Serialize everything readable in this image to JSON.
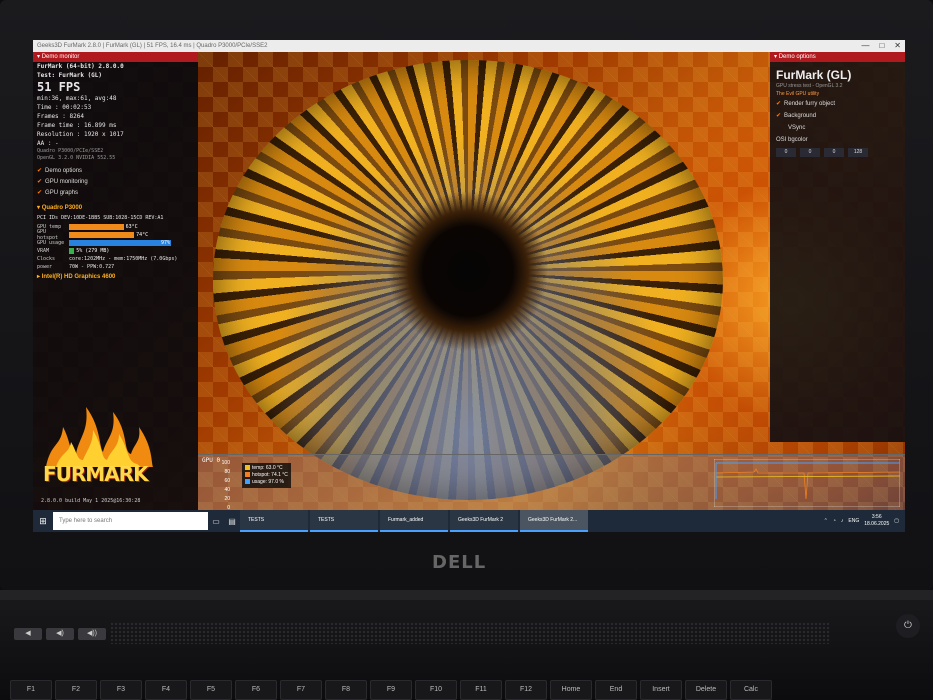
{
  "window": {
    "title": "Geeks3D FurMark 2.8.0   |  FurMark (GL)  |  51 FPS, 16.4 ms  |  Quadro P3000/PCIe/SSE2",
    "min": "—",
    "max": "□",
    "close": "✕"
  },
  "monitor": {
    "header": "Demo monitor",
    "app_name": "FurMark (64-bit) 2.8.0.0",
    "test": "Test: FurMark (GL)",
    "fps": "51 FPS",
    "fps_stats": "min:36, max:61, avg:48",
    "time": "Time         : 00:02:53",
    "frames": "Frames       : 8264",
    "frame_time": "Frame time   : 16.899 ms",
    "resolution": "Resolution   : 1920 x 1017",
    "aa": "AA           : -",
    "gpu_line1": "Quadro P3000/PCIe/SSE2",
    "gpu_line2": "OpenGL 3.2.0 NVIDIA 552.55",
    "options": [
      "Demo options",
      "GPU monitoring",
      "GPU graphs"
    ],
    "gpu_name": "Quadro P3000",
    "pci": "PCI IDs   DEV:10DE-1BB5 SUB:1028-15CD REV:A1",
    "sensors": [
      {
        "label": "GPU temp",
        "value": "63°C",
        "level": 0.52,
        "color": "#f08a1a"
      },
      {
        "label": "GPU hotspot",
        "value": "74°C",
        "level": 0.62,
        "color": "#f08a1a"
      },
      {
        "label": "GPU usage",
        "value": "97%",
        "level": 0.97,
        "color": "#2a82e0"
      },
      {
        "label": "VRAM",
        "value": "5% (279 MB)",
        "level": 0.05,
        "color": "#3ab050"
      }
    ],
    "clocks": "core:1202MHz - mem:1750MHz (7.0Gbps)",
    "power": "70W - PPW:0.727",
    "intel": "Intel(R) HD Graphics 4600",
    "logo": "FURMARK",
    "build": "2.8.0.0 build May 1 2025@16:30:28"
  },
  "options_panel": {
    "header": "Demo options",
    "title": "FurMark (GL)",
    "subtitle": "GPU stress test - OpenGL 3.2",
    "tagline": "The Evil GPU utility",
    "items": [
      "Render furry object",
      "Background",
      "VSync"
    ],
    "osi_label": "OSI bgcolor",
    "osi_values": [
      "0",
      "0",
      "0",
      "128"
    ]
  },
  "graph": {
    "title": "GPU 0",
    "axis": [
      "100",
      "80",
      "60",
      "40",
      "20",
      "0"
    ],
    "legend": [
      {
        "text": "temp: 63.0 °C",
        "color": "#f0c020"
      },
      {
        "text": "hotspot: 74.1 °C",
        "color": "#f08020"
      },
      {
        "text": "usage: 97.0 %",
        "color": "#40a0ff"
      }
    ]
  },
  "taskbar": {
    "search_placeholder": "Type here to search",
    "apps": [
      "TESTS",
      "TESTS",
      "Furmark_added",
      "Geeks3D FurMark 2",
      "Geeks3D FurMark 2..."
    ],
    "lang": "ENG",
    "time": "3:56",
    "date": "18.06.2025"
  },
  "laptop": {
    "brand": "DELL",
    "fkeys": [
      "F1",
      "F2",
      "F3",
      "F4",
      "F5",
      "F6",
      "F7",
      "F8",
      "F9",
      "F10",
      "F11",
      "F12",
      "Home",
      "End",
      "Insert",
      "Delete",
      "Calc"
    ]
  }
}
